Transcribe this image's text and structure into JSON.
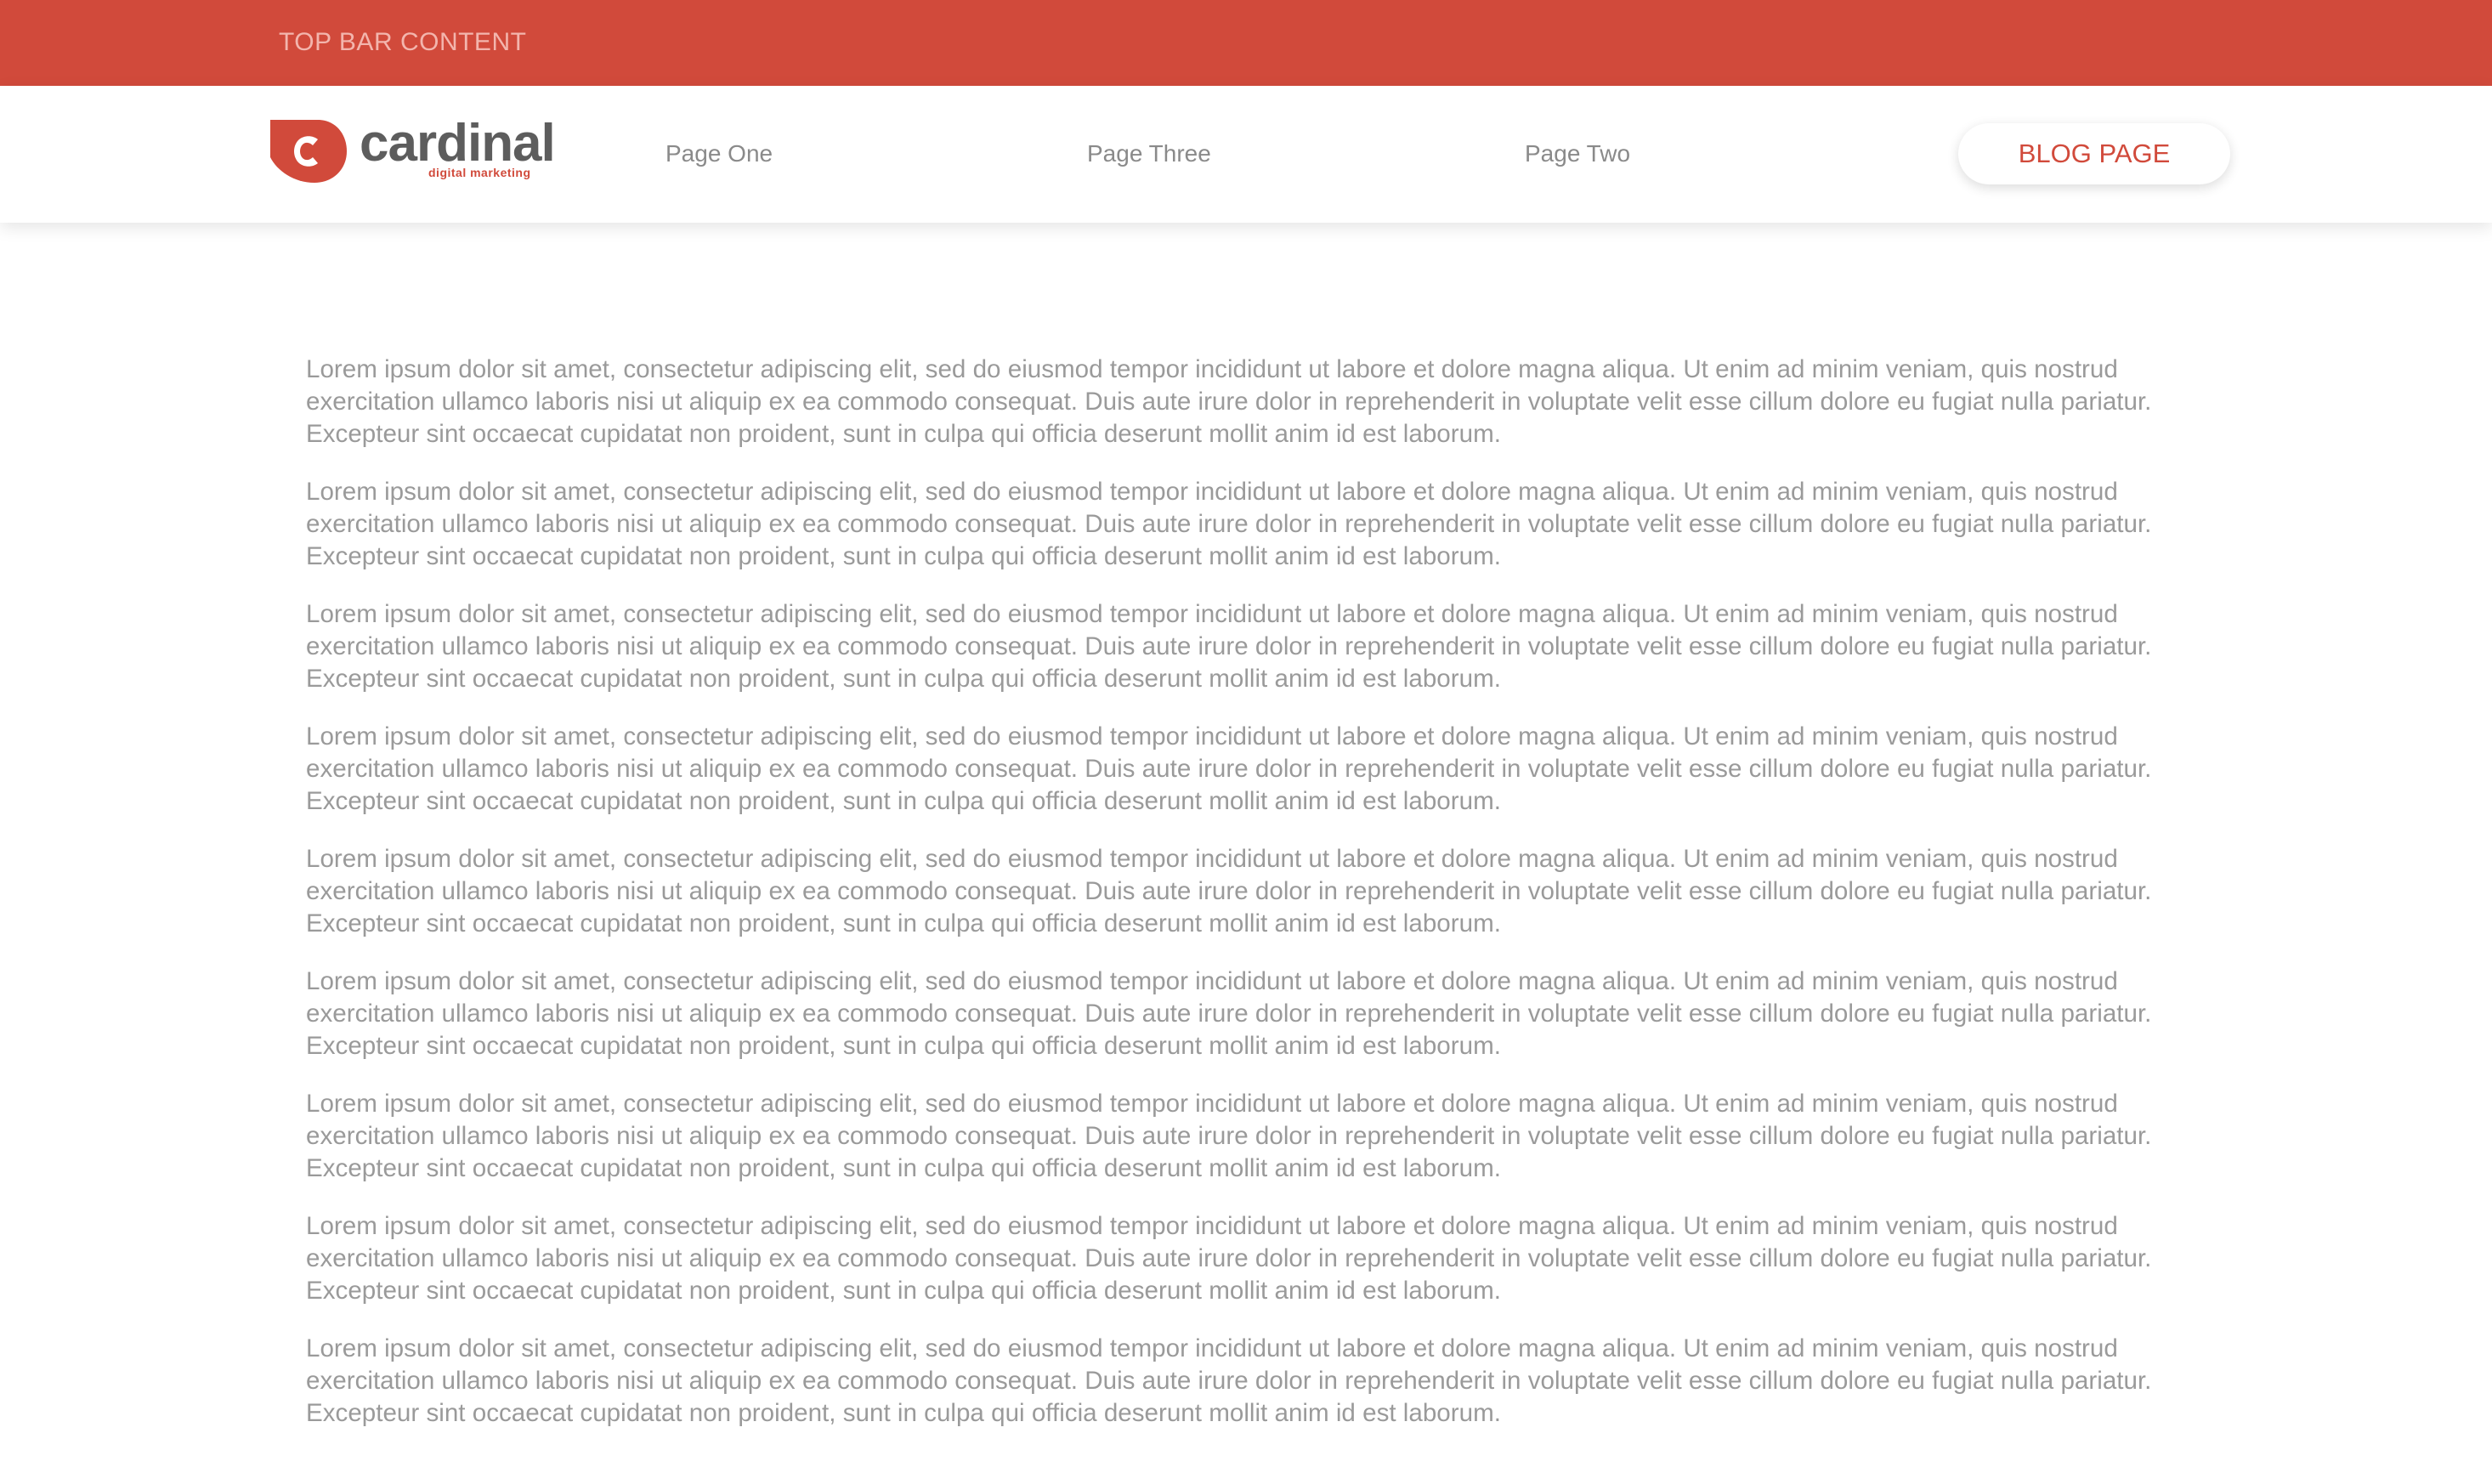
{
  "top_bar": {
    "text": "TOP BAR CONTENT"
  },
  "header": {
    "logo": {
      "wordmark": "cardinal",
      "tagline": "digital marketing",
      "icon": "cardinal-logo-icon"
    },
    "nav": {
      "page_one": "Page One",
      "page_three": "Page Three",
      "page_two": "Page Two",
      "blog": "BLOG PAGE"
    }
  },
  "main": {
    "paragraphs": [
      "Lorem ipsum dolor sit amet, consectetur adipiscing elit, sed do eiusmod tempor incididunt ut labore et dolore magna aliqua. Ut enim ad minim veniam, quis nostrud exercitation ullamco laboris nisi ut aliquip ex ea commodo consequat. Duis aute irure dolor in reprehenderit in voluptate velit esse cillum dolore eu fugiat nulla pariatur. Excepteur sint occaecat cupidatat non proident, sunt in culpa qui officia deserunt mollit anim id est laborum.",
      "Lorem ipsum dolor sit amet, consectetur adipiscing elit, sed do eiusmod tempor incididunt ut labore et dolore magna aliqua. Ut enim ad minim veniam, quis nostrud exercitation ullamco laboris nisi ut aliquip ex ea commodo consequat. Duis aute irure dolor in reprehenderit in voluptate velit esse cillum dolore eu fugiat nulla pariatur. Excepteur sint occaecat cupidatat non proident, sunt in culpa qui officia deserunt mollit anim id est laborum.",
      "Lorem ipsum dolor sit amet, consectetur adipiscing elit, sed do eiusmod tempor incididunt ut labore et dolore magna aliqua. Ut enim ad minim veniam, quis nostrud exercitation ullamco laboris nisi ut aliquip ex ea commodo consequat. Duis aute irure dolor in reprehenderit in voluptate velit esse cillum dolore eu fugiat nulla pariatur. Excepteur sint occaecat cupidatat non proident, sunt in culpa qui officia deserunt mollit anim id est laborum.",
      "Lorem ipsum dolor sit amet, consectetur adipiscing elit, sed do eiusmod tempor incididunt ut labore et dolore magna aliqua. Ut enim ad minim veniam, quis nostrud exercitation ullamco laboris nisi ut aliquip ex ea commodo consequat. Duis aute irure dolor in reprehenderit in voluptate velit esse cillum dolore eu fugiat nulla pariatur. Excepteur sint occaecat cupidatat non proident, sunt in culpa qui officia deserunt mollit anim id est laborum.",
      "Lorem ipsum dolor sit amet, consectetur adipiscing elit, sed do eiusmod tempor incididunt ut labore et dolore magna aliqua. Ut enim ad minim veniam, quis nostrud exercitation ullamco laboris nisi ut aliquip ex ea commodo consequat. Duis aute irure dolor in reprehenderit in voluptate velit esse cillum dolore eu fugiat nulla pariatur. Excepteur sint occaecat cupidatat non proident, sunt in culpa qui officia deserunt mollit anim id est laborum.",
      "Lorem ipsum dolor sit amet, consectetur adipiscing elit, sed do eiusmod tempor incididunt ut labore et dolore magna aliqua. Ut enim ad minim veniam, quis nostrud exercitation ullamco laboris nisi ut aliquip ex ea commodo consequat. Duis aute irure dolor in reprehenderit in voluptate velit esse cillum dolore eu fugiat nulla pariatur. Excepteur sint occaecat cupidatat non proident, sunt in culpa qui officia deserunt mollit anim id est laborum.",
      "Lorem ipsum dolor sit amet, consectetur adipiscing elit, sed do eiusmod tempor incididunt ut labore et dolore magna aliqua. Ut enim ad minim veniam, quis nostrud exercitation ullamco laboris nisi ut aliquip ex ea commodo consequat. Duis aute irure dolor in reprehenderit in voluptate velit esse cillum dolore eu fugiat nulla pariatur. Excepteur sint occaecat cupidatat non proident, sunt in culpa qui officia deserunt mollit anim id est laborum.",
      "Lorem ipsum dolor sit amet, consectetur adipiscing elit, sed do eiusmod tempor incididunt ut labore et dolore magna aliqua. Ut enim ad minim veniam, quis nostrud exercitation ullamco laboris nisi ut aliquip ex ea commodo consequat. Duis aute irure dolor in reprehenderit in voluptate velit esse cillum dolore eu fugiat nulla pariatur. Excepteur sint occaecat cupidatat non proident, sunt in culpa qui officia deserunt mollit anim id est laborum.",
      "Lorem ipsum dolor sit amet, consectetur adipiscing elit, sed do eiusmod tempor incididunt ut labore et dolore magna aliqua. Ut enim ad minim veniam, quis nostrud exercitation ullamco laboris nisi ut aliquip ex ea commodo consequat. Duis aute irure dolor in reprehenderit in voluptate velit esse cillum dolore eu fugiat nulla pariatur. Excepteur sint occaecat cupidatat non proident, sunt in culpa qui officia deserunt mollit anim id est laborum."
    ]
  },
  "colors": {
    "brand_red": "#d14a3b",
    "logo_gray": "#5d5d5d",
    "nav_text": "#8a8a8a",
    "body_text": "#9a9a9a",
    "top_bar_text": "#f3b5ad"
  }
}
